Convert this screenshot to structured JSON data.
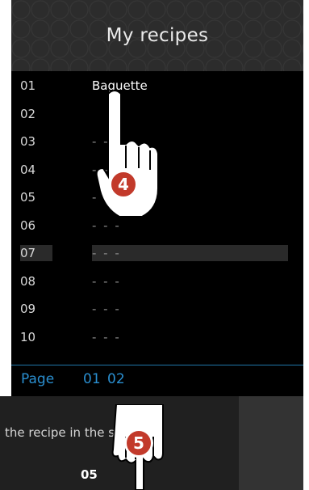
{
  "header": {
    "title": "My recipes"
  },
  "recipes": [
    {
      "num": "01",
      "name": "Baguette"
    },
    {
      "num": "02",
      "name": ""
    },
    {
      "num": "03",
      "name": "- - -"
    },
    {
      "num": "04",
      "name": "- - -"
    },
    {
      "num": "05",
      "name": "- - -"
    },
    {
      "num": "06",
      "name": "- - -"
    },
    {
      "num": "07",
      "name": "- - -"
    },
    {
      "num": "08",
      "name": "- - -"
    },
    {
      "num": "09",
      "name": "- - -"
    },
    {
      "num": "10",
      "name": "- - -"
    }
  ],
  "pagination": {
    "label": "Page",
    "pages": [
      "01",
      "02"
    ]
  },
  "dialog": {
    "message": "the recipe in the        sition",
    "value": "05"
  },
  "steps": {
    "step_a": "4",
    "step_b": "5"
  },
  "colors": {
    "accent": "#2a8fd0",
    "badge": "#c23a2b",
    "selected_row": "#2a2a2a"
  }
}
